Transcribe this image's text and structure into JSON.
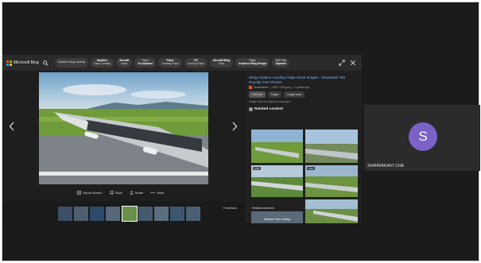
{
  "bing": {
    "brand": "Microsoft Bing",
    "chips": [
      {
        "line1": "Airplane Wing Landing",
        "line2": ""
      },
      {
        "line1": "Airplane",
        "line2": "Flaps Landing"
      },
      {
        "line1": "Aircraft",
        "line2": "Flaps"
      },
      {
        "line1": "Flaps",
        "line2": "On Airplane"
      },
      {
        "line1": "Plane",
        "line2": "Landing Flaps"
      },
      {
        "line1": "747",
        "line2": "Landing Flaps"
      },
      {
        "line1": "Aircraft Wing",
        "line2": "Flap"
      },
      {
        "line1": "Flaps",
        "line2": "Airplane Wing Design"
      },
      {
        "line1": "Split Flap",
        "line2": "Airplane"
      }
    ]
  },
  "viewer": {
    "actions": [
      "Visual Search",
      "Save",
      "Share",
      "More"
    ],
    "feedback": "Feedback"
  },
  "details": {
    "title": "Wing Airplane Landing Flaps Stock Images - Download 759 Royalty Free Photos",
    "source": "Dreamstime",
    "size": "800 × 533 jpeg",
    "age": "4 years ago",
    "visit_label": "Visit site",
    "pages_label": "Pages",
    "image_size_label": "Image sizes",
    "copyright": "Image may be subject to copyright.",
    "related_heading": "Related content",
    "badges": [
      "3:26",
      "3:26"
    ],
    "related_searches": "Related searches",
    "rs_label": "Airplane Flap Landing"
  },
  "participant": {
    "initial": "S",
    "name": "SHRIRAKAVI CHE",
    "avatar_color": "#7b62c9"
  }
}
